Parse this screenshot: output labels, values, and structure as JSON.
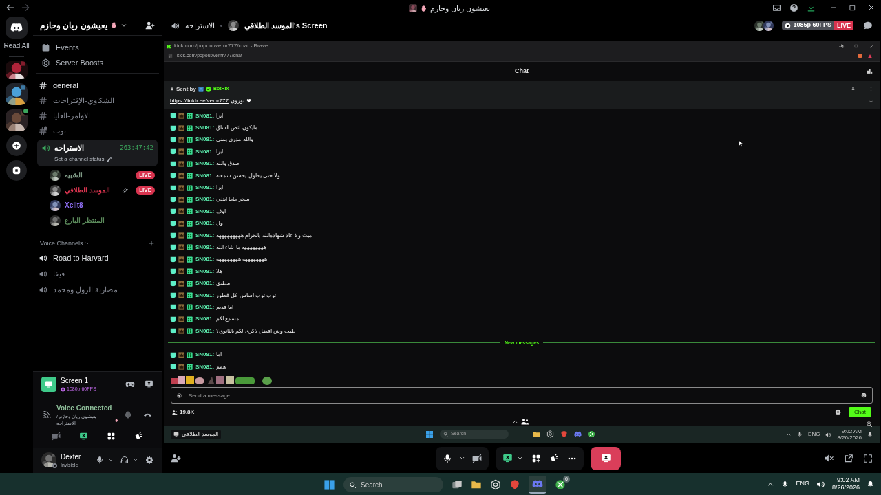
{
  "title_bar": {
    "title": "يعيشون ريان وحازم"
  },
  "server_rail": {
    "read_all": "Read All"
  },
  "sidebar": {
    "server_name": "يعيشون ريان وحازم",
    "links": [
      {
        "kind": "events",
        "label": "Events"
      },
      {
        "kind": "boosts",
        "label": "Server Boosts"
      }
    ],
    "text_channels": [
      {
        "kind": "text",
        "name": "general",
        "unread": true
      },
      {
        "kind": "text",
        "name": "الشكاوي-الإقتراحات",
        "unread": false
      },
      {
        "kind": "text",
        "name": "الاوامر-العليا",
        "unread": false
      },
      {
        "kind": "thread",
        "name": "بوت",
        "unread": false
      }
    ],
    "active_voice": {
      "name": "الاستراحه",
      "timer": "263:47:42",
      "status": "Set a channel status",
      "members": [
        {
          "name": "الشبيه",
          "color": "#7f9a86",
          "live": "LIVE",
          "deafened": false
        },
        {
          "name": "الموسد الطلاقي",
          "color": "#d9344f",
          "live": "LIVE",
          "deafened": true
        },
        {
          "name": "Xcilt8",
          "color": "#8f6ff5",
          "deafened": false
        },
        {
          "name": "المنتظر البارع",
          "color": "#5b8a5b",
          "deafened": false
        }
      ]
    },
    "voice_header": "Voice Channels",
    "voice_channels": [
      {
        "name": "Road to Harvard",
        "unread": true
      },
      {
        "name": "فيفا",
        "unread": false
      },
      {
        "name": "مضاربة الزول ومحمد",
        "unread": false
      }
    ]
  },
  "stream_card": {
    "title": "Screen 1",
    "quality": "1080p 60FPS"
  },
  "voice_status": {
    "label": "Voice Connected",
    "location": "يعيشون ريان وحازم / الاستراحه"
  },
  "user": {
    "name": "Dexter",
    "status": "Invisible"
  },
  "header": {
    "channel": "الاستراحه",
    "stream": "الموسد الطلاقي's Screen",
    "quality": "1085p 60FPS",
    "live": "LIVE"
  },
  "browser": {
    "window_title": "kick.com/popout/vemr777/chat - Brave",
    "url": "kick.com/popout/vemr777/chat",
    "chat_title": "Chat",
    "pinned": {
      "sent_by": "Sent by",
      "bot": "BotRix",
      "link": "https://linktr.ee/vemr777",
      "text": "تورون"
    },
    "messages": [
      {
        "kind": "message",
        "user": "SN081:",
        "text": "ابرا"
      },
      {
        "kind": "message",
        "user": "SN081:",
        "text": "مايكون لنص الساق"
      },
      {
        "kind": "message",
        "user": "SN081:",
        "text": "والله مدري يمني"
      },
      {
        "kind": "message",
        "user": "SN081:",
        "text": "ابرا"
      },
      {
        "kind": "message",
        "user": "SN081:",
        "text": "صدق والله"
      },
      {
        "kind": "message",
        "user": "SN081:",
        "text": "ولا حتى يحاول يحسن سمعته"
      },
      {
        "kind": "message",
        "user": "SN081:",
        "text": "ابرا"
      },
      {
        "kind": "message",
        "user": "SN081:",
        "text": "سجر ماما ابتلي"
      },
      {
        "kind": "message",
        "user": "SN081:",
        "text": "اوف"
      },
      {
        "kind": "message",
        "user": "SN081:",
        "text": "ول"
      },
      {
        "kind": "message",
        "user": "SN081:",
        "text": "ميت ولا عاد شهادةالله بالحرام هههههههههه"
      },
      {
        "kind": "message",
        "user": "SN081:",
        "text": "ههههههههه ما شاء الله"
      },
      {
        "kind": "message",
        "user": "SN081:",
        "text": "ههههههههه ههههههههه"
      },
      {
        "kind": "message",
        "user": "SN081:",
        "text": "هلا"
      },
      {
        "kind": "message",
        "user": "SN081:",
        "text": "مطبق"
      },
      {
        "kind": "message",
        "user": "SN081:",
        "text": "توب توب اساس كل فطور"
      },
      {
        "kind": "message",
        "user": "SN081:",
        "text": "اما قديم"
      },
      {
        "kind": "message",
        "user": "SN081:",
        "text": "مسمع لكم"
      },
      {
        "kind": "message",
        "user": "SN081:",
        "text": "طيب وش افضل ذكرى لكم بالثانوي؟"
      },
      {
        "kind": "divider",
        "label": "New messages"
      },
      {
        "kind": "message",
        "user": "SN081:",
        "text": "اما"
      },
      {
        "kind": "message",
        "user": "SN081:",
        "text": "همم"
      }
    ],
    "input_placeholder": "Send a message",
    "viewers": "19.8K",
    "send": "Chat"
  },
  "stream_taskbar": {
    "window_label": "الموسد الطلاقي",
    "search": "Search",
    "lang": "ENG",
    "time": "9:02 AM",
    "date": "8/26/2026"
  },
  "taskbar": {
    "search": "Search",
    "badge": "6",
    "lang": "ENG",
    "time": "9:02 AM",
    "date": "8/26/2026"
  }
}
